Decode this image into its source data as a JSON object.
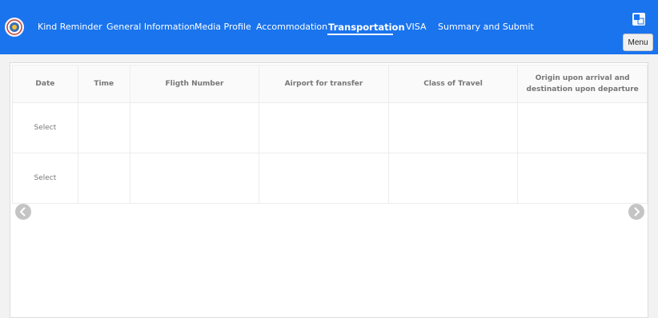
{
  "header": {
    "nav_items": [
      {
        "label": "Kind Reminder",
        "active": false
      },
      {
        "label": "General Information",
        "active": false
      },
      {
        "label": "Media Profile",
        "active": false
      },
      {
        "label": "Accommodation",
        "active": false
      },
      {
        "label": "Transportation",
        "active": true
      },
      {
        "label": "VISA",
        "active": false
      },
      {
        "label": "Summary and Submit",
        "active": false
      }
    ],
    "menu_label": "Menu",
    "accent_color": "#1a74ee"
  },
  "table": {
    "columns": [
      "Date",
      "Time",
      "Fligth Number",
      "Airport for transfer",
      "Class of Travel",
      "Origin upon arrival and destination upon departure"
    ],
    "rows": [
      [
        "Select",
        "",
        "",
        "",
        "",
        ""
      ],
      [
        "Select",
        "",
        "",
        "",
        "",
        ""
      ]
    ]
  },
  "icons": [
    "emblem-logo",
    "language-switch-icon",
    "chevron-left-icon",
    "chevron-right-icon"
  ]
}
